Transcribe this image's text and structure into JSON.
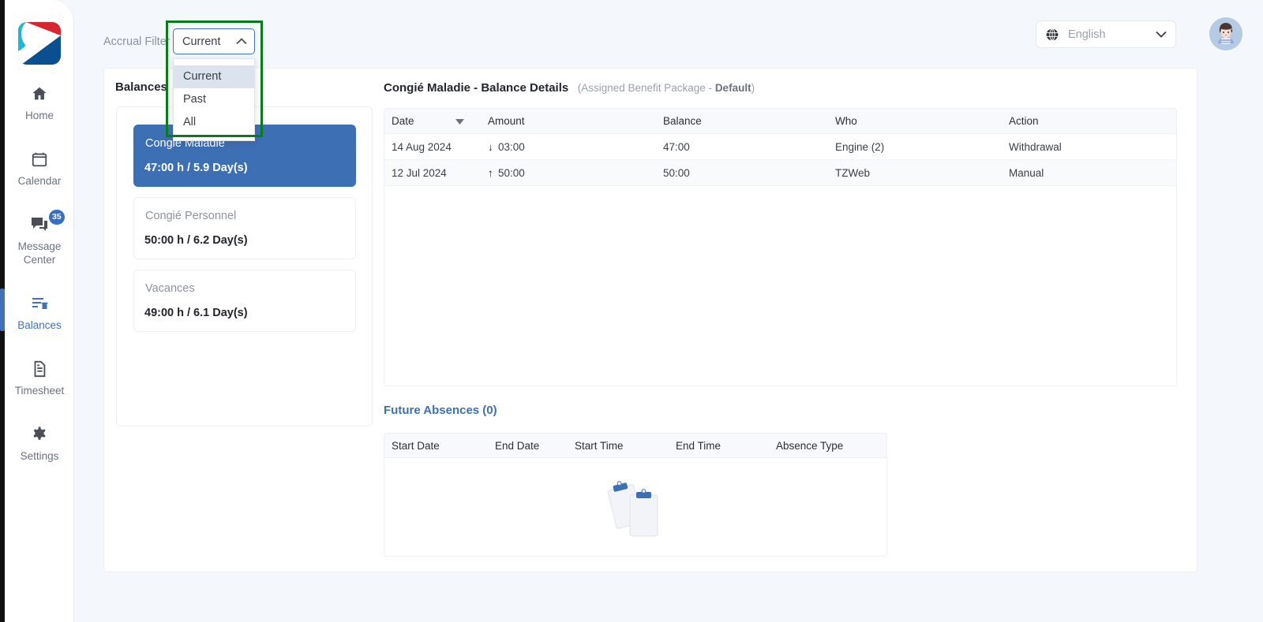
{
  "sidebar": {
    "logo_name": "app-logo",
    "logo_colors": {
      "cyan": "#1cb8d4",
      "red": "#d7262f",
      "navy": "#0a4f8f",
      "white": "#ffffff"
    },
    "items": [
      {
        "label": "Home",
        "icon": "home-icon",
        "active": false,
        "badge": ""
      },
      {
        "label": "Calendar",
        "icon": "calendar-icon",
        "active": false,
        "badge": ""
      },
      {
        "label": "Message Center",
        "icon": "message-icon",
        "active": false,
        "badge": "35"
      },
      {
        "label": "Balances",
        "icon": "balances-icon",
        "active": true,
        "badge": ""
      },
      {
        "label": "Timesheet",
        "icon": "timesheet-icon",
        "active": false,
        "badge": ""
      },
      {
        "label": "Settings",
        "icon": "gear-icon",
        "active": false,
        "badge": ""
      }
    ]
  },
  "topbar": {
    "accrual_filter_label": "Accrual Filter",
    "accrual_filter_value": "Current",
    "accrual_filter_options": [
      "Current",
      "Past",
      "All"
    ],
    "accrual_filter_selected_option": "Current",
    "language_value": "English",
    "language_icon": "globe-icon",
    "avatar_name": "user-avatar",
    "highlight_color": "#0b7a1b",
    "accent_color": "#4271b8"
  },
  "balances_panel": {
    "title": "Balances",
    "cards": [
      {
        "name": "Congié Maladie",
        "value": "47:00 h / 5.9 Day(s)",
        "selected": true
      },
      {
        "name": "Congié Personnel",
        "value": "50:00 h / 6.2 Day(s)",
        "selected": false
      },
      {
        "name": "Vacances",
        "value": "49:00 h / 6.1 Day(s)",
        "selected": false
      }
    ]
  },
  "details": {
    "title": "Congié Maladie - Balance Details",
    "subtitle_prefix": "(Assigned Benefit Package - ",
    "subtitle_value": "Default",
    "subtitle_suffix": ")",
    "columns": [
      "Date",
      "Amount",
      "Balance",
      "Who",
      "Action"
    ],
    "sort_column": "Date",
    "sort_icon": "sort-descending-caret",
    "rows": [
      {
        "date": "14 Aug 2024",
        "arrow": "↓",
        "amount": "03:00",
        "balance": "47:00",
        "who": "Engine (2)",
        "action": "Withdrawal"
      },
      {
        "date": "12 Jul 2024",
        "arrow": "↑",
        "amount": "50:00",
        "balance": "50:00",
        "who": "TZWeb",
        "action": "Manual"
      }
    ]
  },
  "future_absences": {
    "title": "Future Absences (0)",
    "count": 0,
    "columns": [
      "Start Date",
      "End Date",
      "Start Time",
      "End Time",
      "Absence Type"
    ],
    "empty_illustration": "empty-clipboards-illustration"
  }
}
